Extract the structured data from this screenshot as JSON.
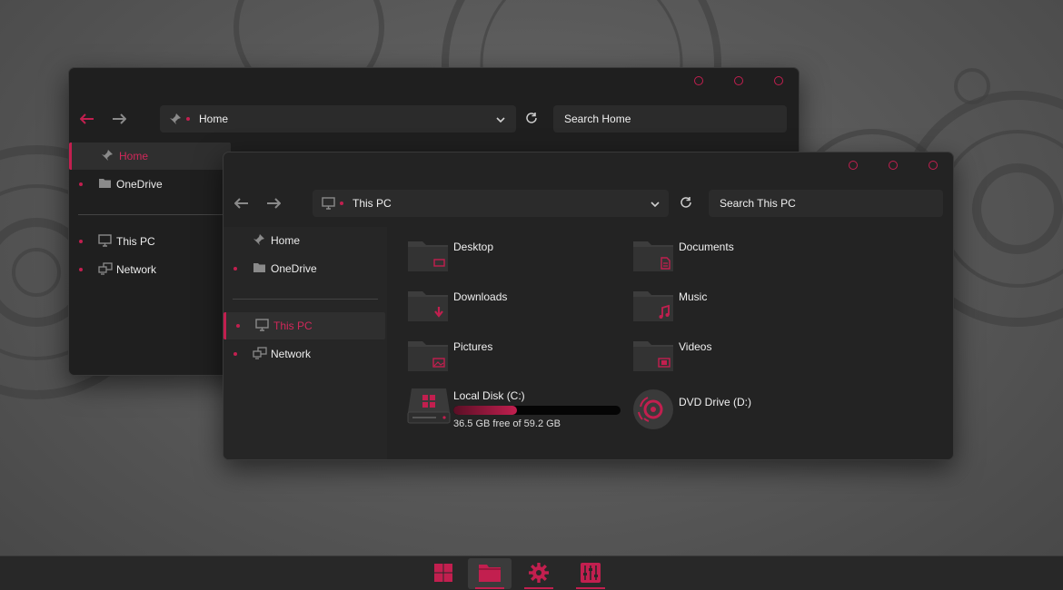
{
  "colors": {
    "accent": "#c21f4f",
    "window_bg": "#1f1f1f",
    "field_bg": "#2b2b2b"
  },
  "back_window": {
    "address": {
      "location": "Home",
      "location_icon": "pin-icon"
    },
    "search_placeholder": "Search Home",
    "sidebar": [
      {
        "label": "Home",
        "icon": "pin-icon",
        "active": true
      },
      {
        "label": "OneDrive",
        "icon": "folder-icon"
      },
      {
        "label": "This PC",
        "icon": "monitor-icon"
      },
      {
        "label": "Network",
        "icon": "network-icon"
      }
    ]
  },
  "front_window": {
    "address": {
      "location": "This PC",
      "location_icon": "monitor-icon"
    },
    "search_placeholder": "Search This PC",
    "sidebar": [
      {
        "label": "Home",
        "icon": "pin-icon"
      },
      {
        "label": "OneDrive",
        "icon": "folder-icon"
      },
      {
        "label": "This PC",
        "icon": "monitor-icon",
        "active": true
      },
      {
        "label": "Network",
        "icon": "network-icon"
      }
    ],
    "folders": [
      {
        "label": "Desktop",
        "icon": "desktop-folder-icon"
      },
      {
        "label": "Documents",
        "icon": "documents-folder-icon"
      },
      {
        "label": "Downloads",
        "icon": "downloads-folder-icon"
      },
      {
        "label": "Music",
        "icon": "music-folder-icon"
      },
      {
        "label": "Pictures",
        "icon": "pictures-folder-icon"
      },
      {
        "label": "Videos",
        "icon": "videos-folder-icon"
      }
    ],
    "drives": [
      {
        "label": "Local Disk (C:)",
        "free_text": "36.5 GB free of 59.2 GB",
        "used_fraction": 0.38,
        "icon": "hard-drive-icon"
      },
      {
        "label": "DVD Drive (D:)",
        "icon": "dvd-drive-icon"
      }
    ]
  },
  "taskbar": [
    {
      "icon": "start-icon"
    },
    {
      "icon": "file-explorer-icon",
      "active": true
    },
    {
      "icon": "settings-gear-icon"
    },
    {
      "icon": "control-panel-icon"
    }
  ]
}
